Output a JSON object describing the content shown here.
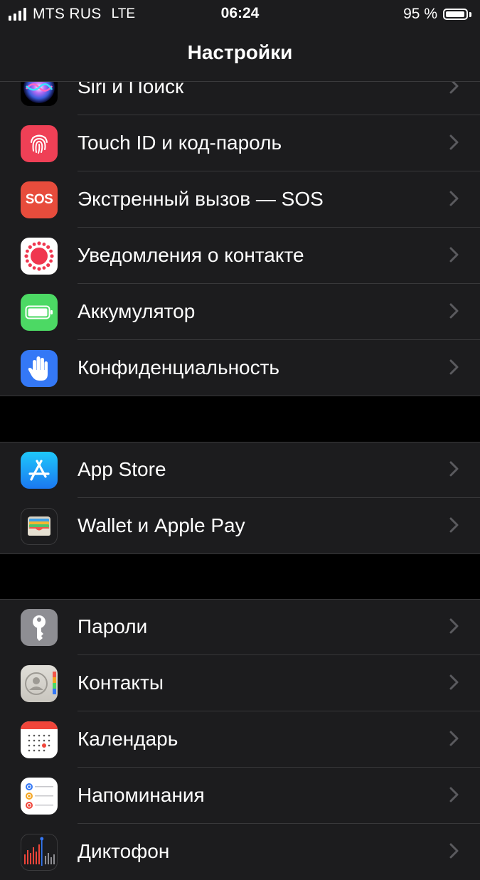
{
  "status_bar": {
    "carrier": "MTS RUS",
    "network": "LTE",
    "time": "06:24",
    "battery_percent_text": "95 %",
    "battery_level": 0.95,
    "signal_bars": 4
  },
  "nav": {
    "title": "Настройки"
  },
  "groups": [
    {
      "items": [
        {
          "label": "Siri и Поиск",
          "icon": "siri-icon"
        },
        {
          "label": "Touch ID и код-пароль",
          "icon": "fingerprint-icon",
          "icon_color": "#ef4056"
        },
        {
          "label": "Экстренный вызов — SOS",
          "icon": "sos-icon",
          "icon_color": "#e74c3c",
          "icon_text": "SOS"
        },
        {
          "label": "Уведомления о контакте",
          "icon": "exposure-notification-icon",
          "icon_color": "#ffffff"
        },
        {
          "label": "Аккумулятор",
          "icon": "battery-icon",
          "icon_color": "#4cd964"
        },
        {
          "label": "Конфиденциальность",
          "icon": "hand-icon",
          "icon_color": "#3478f6"
        }
      ]
    },
    {
      "items": [
        {
          "label": "App Store",
          "icon": "app-store-icon",
          "icon_color": "#1e9bf0"
        },
        {
          "label": "Wallet и Apple Pay",
          "icon": "wallet-icon",
          "icon_color": "#1c1c1e"
        }
      ]
    },
    {
      "items": [
        {
          "label": "Пароли",
          "icon": "key-icon",
          "icon_color": "#8e8e93"
        },
        {
          "label": "Контакты",
          "icon": "contacts-icon",
          "icon_color": "#d8d6d0"
        },
        {
          "label": "Календарь",
          "icon": "calendar-icon",
          "icon_color": "#ffffff"
        },
        {
          "label": "Напоминания",
          "icon": "reminders-icon",
          "icon_color": "#ffffff"
        },
        {
          "label": "Диктофон",
          "icon": "voice-memos-icon",
          "icon_color": "#1c1c1e"
        }
      ]
    }
  ],
  "colors": {
    "background": "#000000",
    "cell": "#1c1c1e",
    "separator": "#38383a",
    "chevron": "#5a5a5e",
    "label": "#ffffff"
  }
}
